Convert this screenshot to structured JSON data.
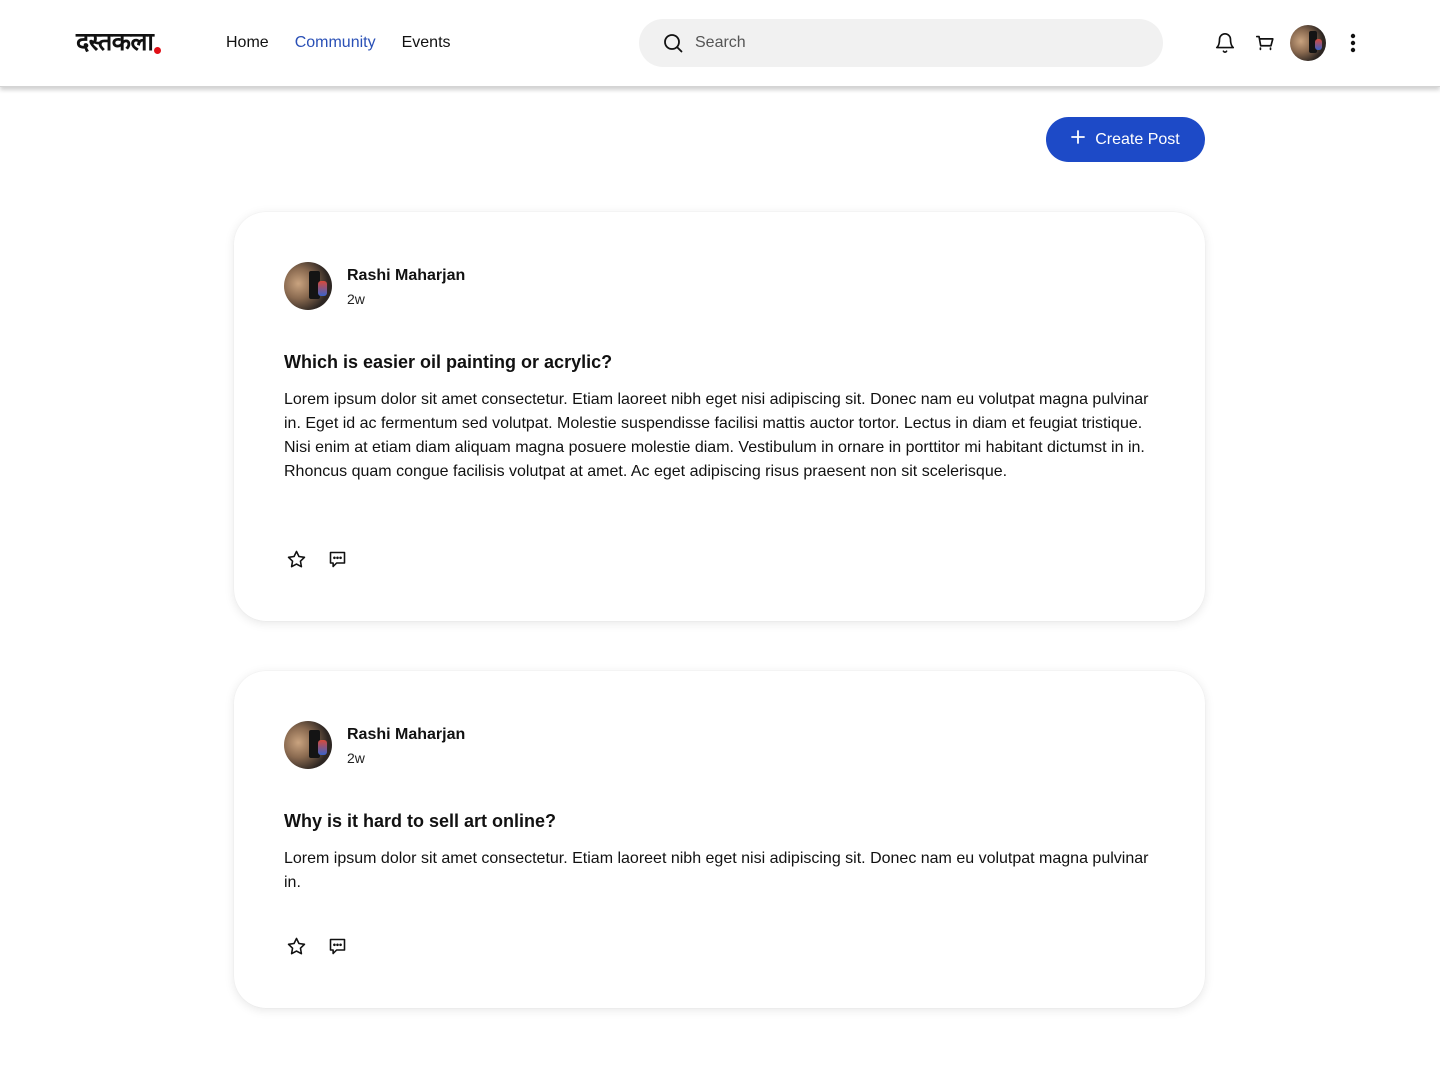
{
  "header": {
    "logo_text": "दस्तकला",
    "nav": [
      {
        "label": "Home",
        "active": false
      },
      {
        "label": "Community",
        "active": true
      },
      {
        "label": "Events",
        "active": false
      }
    ],
    "search": {
      "placeholder": "Search",
      "value": ""
    },
    "icons": [
      "bell-icon",
      "cart-icon",
      "user-avatar",
      "more-vertical-icon"
    ]
  },
  "actions": {
    "create_post_label": "Create Post",
    "create_post_icon": "plus-icon"
  },
  "posts": [
    {
      "author": "Rashi Maharjan",
      "time": "2w",
      "title": "Which is easier oil painting or acrylic?",
      "body": "Lorem ipsum dolor sit amet consectetur. Etiam laoreet nibh eget nisi adipiscing sit. Donec nam eu volutpat magna pulvinar in. Eget id ac fermentum sed volutpat. Molestie suspendisse facilisi mattis auctor tortor. Lectus in diam et feugiat tristique. Nisi enim at etiam diam aliquam magna posuere molestie diam. Vestibulum in ornare in porttitor mi habitant dictumst in in. Rhoncus quam congue facilisis volutpat at amet. Ac eget adipiscing risus praesent non sit scelerisque.",
      "actions": [
        "star-icon",
        "comment-icon"
      ]
    },
    {
      "author": "Rashi Maharjan",
      "time": "2w",
      "title": "Why is it hard to sell art online?",
      "body": "Lorem ipsum dolor sit amet consectetur. Etiam laoreet nibh eget nisi adipiscing sit. Donec nam eu volutpat magna pulvinar in.",
      "actions": [
        "star-icon",
        "comment-icon"
      ]
    }
  ],
  "colors": {
    "accent": "#1d4ac7",
    "nav_active": "#2a50b6",
    "logo_dot": "#e10f17",
    "search_bg": "#f1f1f1"
  }
}
